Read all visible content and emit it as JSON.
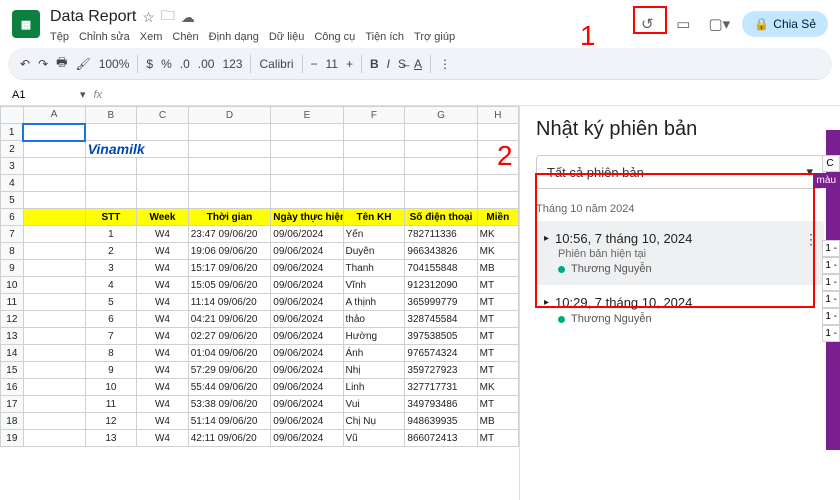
{
  "header": {
    "doc_title": "Data Report",
    "menus": [
      "Tệp",
      "Chỉnh sửa",
      "Xem",
      "Chèn",
      "Định dạng",
      "Dữ liệu",
      "Công cụ",
      "Tiện ích",
      "Trợ giúp"
    ],
    "share_label": "Chia Sẻ"
  },
  "toolbar": {
    "zoom": "100%",
    "font": "Calibri",
    "size": "11"
  },
  "namebox": {
    "cell": "A1"
  },
  "columns": [
    "A",
    "B",
    "C",
    "D",
    "E",
    "F",
    "G",
    "H"
  ],
  "brand_text": "Vinamilk",
  "table_header": [
    "STT",
    "Week",
    "Thời gian",
    "Ngày thực hiện",
    "Tên KH",
    "Số điện thoại",
    "Miền"
  ],
  "rows": [
    [
      "1",
      "W4",
      "23:47 09/06/20",
      "09/06/2024",
      "Yến",
      "782711336",
      "MK"
    ],
    [
      "2",
      "W4",
      "19:06 09/06/20",
      "09/06/2024",
      "Duyên",
      "966343826",
      "MK"
    ],
    [
      "3",
      "W4",
      "15:17 09/06/20",
      "09/06/2024",
      "Thanh",
      "704155848",
      "MB"
    ],
    [
      "4",
      "W4",
      "15:05 09/06/20",
      "09/06/2024",
      "Vĩnh",
      "912312090",
      "MT"
    ],
    [
      "5",
      "W4",
      "11:14 09/06/20",
      "09/06/2024",
      "A thịnh",
      "365999779",
      "MT"
    ],
    [
      "6",
      "W4",
      "04:21 09/06/20",
      "09/06/2024",
      "thảo",
      "328745584",
      "MT"
    ],
    [
      "7",
      "W4",
      "02:27 09/06/20",
      "09/06/2024",
      "Hường",
      "397538505",
      "MT"
    ],
    [
      "8",
      "W4",
      "01:04 09/06/20",
      "09/06/2024",
      "Ánh",
      "976574324",
      "MT"
    ],
    [
      "9",
      "W4",
      "57:29 09/06/20",
      "09/06/2024",
      "Nhị",
      "359727923",
      "MT"
    ],
    [
      "10",
      "W4",
      "55:44 09/06/20",
      "09/06/2024",
      "Linh",
      "327717731",
      "MK"
    ],
    [
      "11",
      "W4",
      "53:38 09/06/20",
      "09/06/2024",
      "Vui",
      "349793486",
      "MT"
    ],
    [
      "12",
      "W4",
      "51:14 09/06/20",
      "09/06/2024",
      "Chị Nụ",
      "948639935",
      "MB"
    ],
    [
      "13",
      "W4",
      "42:11 09/06/20",
      "09/06/2024",
      "Vũ",
      "866072413",
      "MT"
    ]
  ],
  "panel": {
    "title": "Nhật ký phiên bản",
    "dropdown": "Tất cả phiên bản",
    "month": "Tháng 10 năm 2024",
    "versions": [
      {
        "time": "10:56, 7 tháng 10, 2024",
        "sub": "Phiên bản hiện tại",
        "user": "Thương Nguyễn",
        "active": true
      },
      {
        "time": "10:29, 7 tháng 10, 2024",
        "sub": "",
        "user": "Thương Nguyễn",
        "active": false
      }
    ],
    "side_label": "màu",
    "side_col_hdr": "C",
    "side_vals": [
      "1 -",
      "1 -",
      "1 -",
      "1 -",
      "1 -",
      "1 -"
    ]
  },
  "annotations": {
    "num1": "1",
    "num2": "2"
  }
}
